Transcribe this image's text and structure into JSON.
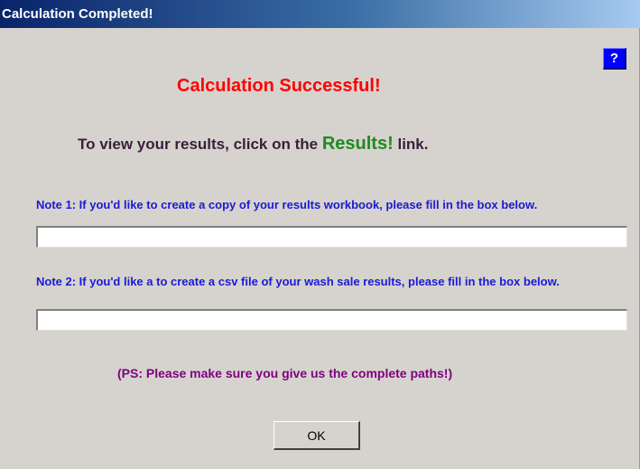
{
  "window": {
    "title": "Calculation Completed!"
  },
  "help_button": {
    "label": "?",
    "color": "#0000ff"
  },
  "message": {
    "success": "Calculation Successful!",
    "view_prefix": "To view your results, click on the",
    "results_link": "Results!",
    "view_suffix": "link."
  },
  "note1": {
    "text": "Note 1: If you'd like to create a copy of your results workbook, please fill in the box below.",
    "value": ""
  },
  "note2": {
    "text": "Note 2: If you'd like a to create a csv file of your wash sale results, please fill in the box below.",
    "value": ""
  },
  "ps": "(PS:  Please make sure you give us the complete paths!)",
  "ok_button": {
    "label": "OK"
  },
  "colors": {
    "title_bar_start": "#0a246a",
    "title_bar_end": "#a6caf0",
    "success": "#ff0000",
    "results_link": "#1f8a1f",
    "note": "#1a1ad6",
    "ps": "#800080",
    "dialog_bg": "#d6d3ce"
  }
}
